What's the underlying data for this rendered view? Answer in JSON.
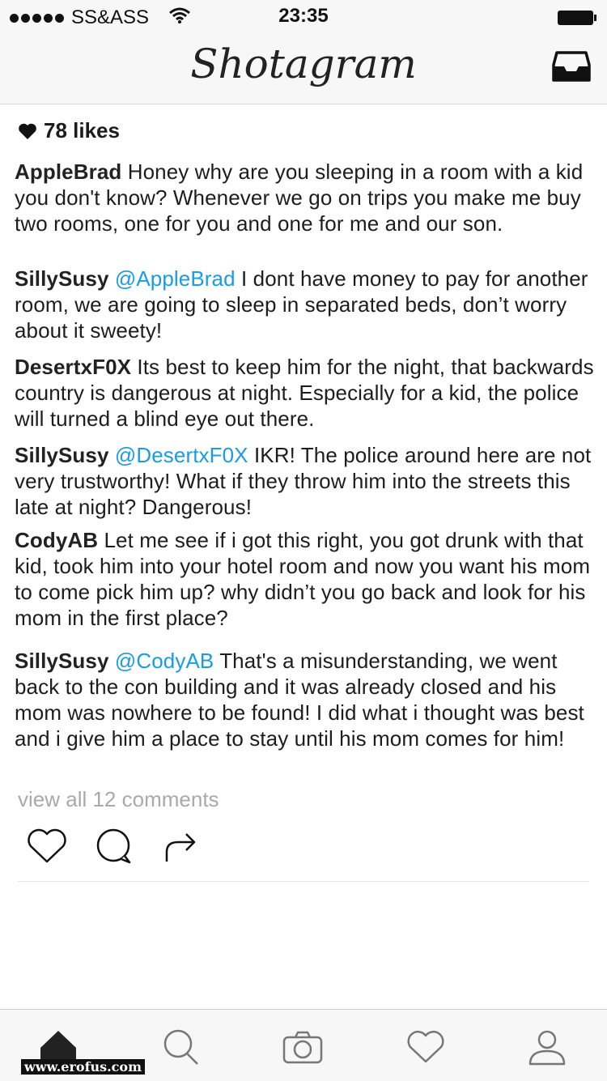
{
  "status_bar": {
    "carrier": "SS&ASS",
    "time": "23:35"
  },
  "header": {
    "logo": "Shotagram",
    "inbox_icon": "inbox-icon"
  },
  "post": {
    "likes": "78 likes",
    "comments": [
      {
        "user": "AppleBrad",
        "mention": "",
        "text": "Honey why are you sleeping in a room with a kid you don't know? Whenever we go on trips you make me buy two rooms, one for you and one for me and our son."
      },
      {
        "user": "SillySusy",
        "mention": "@AppleBrad",
        "text": "I dont have money to pay for another room, we are going to sleep in separated beds, don’t worry about it sweety!"
      },
      {
        "user": "DesertxF0X",
        "mention": "",
        "text": "Its best to keep him for the night, that backwards country is dangerous at night. Especially for a kid, the police will turned a blind eye out there."
      },
      {
        "user": "SillySusy",
        "mention": "@DesertxF0X",
        "text": "IKR! The police around here are not very trustworthy! What if they throw him into the streets this late at night? Dangerous!"
      },
      {
        "user": "CodyAB",
        "mention": "",
        "text": "Let me see if i got this right, you got drunk with that kid, took him into your hotel room and now you want his mom to come pick him up? why didn’t you go back and look for his mom in the first place?"
      },
      {
        "user": "SillySusy",
        "mention": "@CodyAB",
        "text": "That's a misunderstanding, we went back to the con building and it was already closed and his mom was nowhere to be found! I did what i thought was best and i give him a place to stay until his mom comes for him!"
      }
    ],
    "view_all": "view all 12 comments"
  },
  "tab_bar": [
    "home-icon",
    "search-icon",
    "camera-icon",
    "heart-icon",
    "profile-icon"
  ],
  "watermark": "www.erofus.com",
  "colors": {
    "mention": "#1a9be6",
    "muted": "#a9a9a9",
    "bar_bg": "#f7f7f7"
  }
}
